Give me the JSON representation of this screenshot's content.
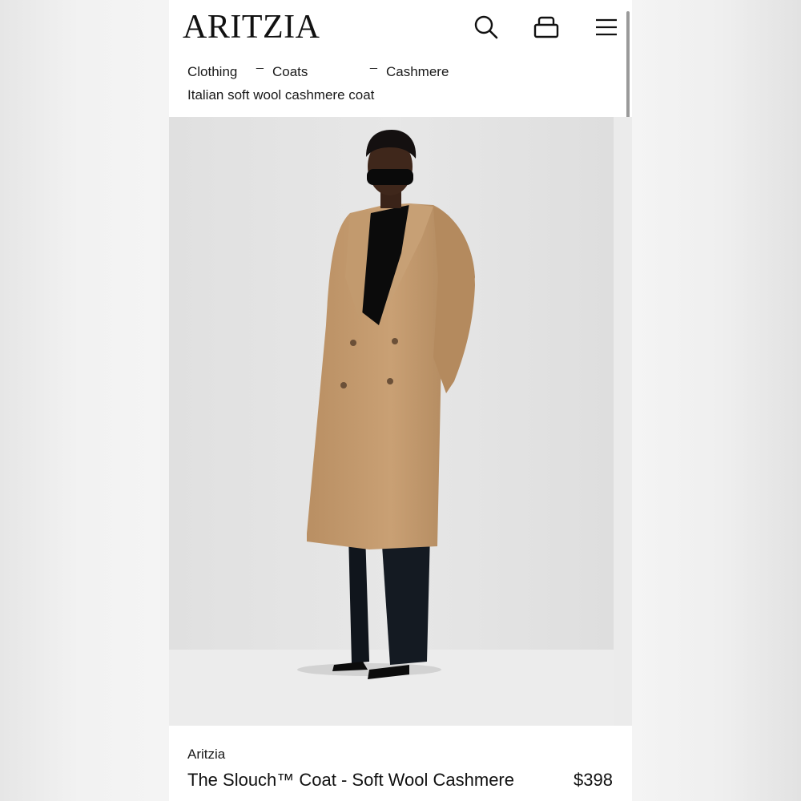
{
  "header": {
    "logo": "ARITZIA",
    "icons": [
      "search-icon",
      "bag-icon",
      "menu-icon"
    ]
  },
  "breadcrumb": {
    "items": [
      "Clothing",
      "Coats",
      "Cashmere"
    ],
    "separator": "_",
    "current": "Italian soft wool cashmere coat"
  },
  "product": {
    "brand": "Aritzia",
    "name": "The Slouch™ Coat - Soft Wool Cashmere",
    "price": "$398",
    "image": "model-in-camel-coat"
  },
  "colors": {
    "text": "#111111",
    "coat": "#c49a6c",
    "background": "#e6e6e6"
  }
}
